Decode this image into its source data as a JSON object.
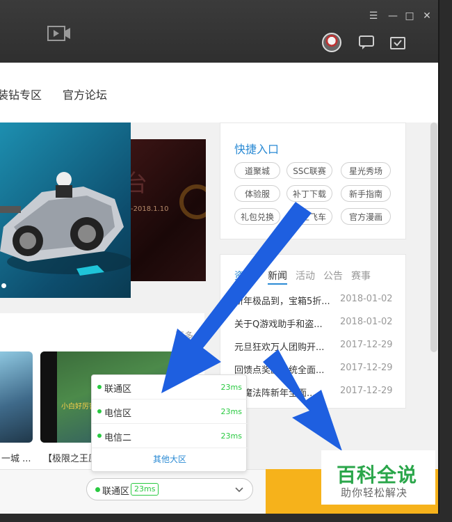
{
  "window": {
    "minimize": "—",
    "maximize": "□",
    "close": "✕",
    "menu": "☰"
  },
  "nav": {
    "item1": "装钻专区",
    "item2": "官方论坛"
  },
  "banner": {
    "date": "-2018.1.10"
  },
  "quick": {
    "title": "快捷入口",
    "tags": [
      "道聚城",
      "SSC联赛",
      "星光秀场",
      "体验服",
      "补丁下载",
      "新手指南",
      "礼包兑换",
      "掌上飞车",
      "官方漫画"
    ]
  },
  "news": {
    "tabs": [
      "资讯",
      "新闻",
      "活动",
      "公告",
      "赛事"
    ],
    "rows": [
      {
        "title": "新年极品到，宝箱5折...",
        "date": "2018-01-02"
      },
      {
        "title": "关于Q游戏助手和盗...",
        "date": "2018-01-02"
      },
      {
        "title": "元旦狂欢万人团购开...",
        "date": "2017-12-29"
      },
      {
        "title": "回馈点奖励系统全面...",
        "date": "2017-12-29"
      },
      {
        "title": "五魔法阵新年全面...",
        "date": "2017-12-29"
      }
    ]
  },
  "videos": {
    "more": "更多",
    "caption1": "一城 ...",
    "caption2": "【极限之王原",
    "watermark_text": "小白好厉害"
  },
  "servers": {
    "items": [
      {
        "name": "联通区",
        "ping": "23ms"
      },
      {
        "name": "电信区",
        "ping": "23ms"
      },
      {
        "name": "电信二",
        "ping": "23ms"
      }
    ],
    "other": "其他大区",
    "selected": {
      "name": "联通区",
      "ping": "23ms"
    }
  },
  "brand": {
    "title": "百科全说",
    "subtitle": "助你轻松解决"
  },
  "colors": {
    "accent": "#2a8ad4",
    "ok": "#28c940",
    "start": "#f6b21b",
    "arrow": "#1e5fe0"
  }
}
